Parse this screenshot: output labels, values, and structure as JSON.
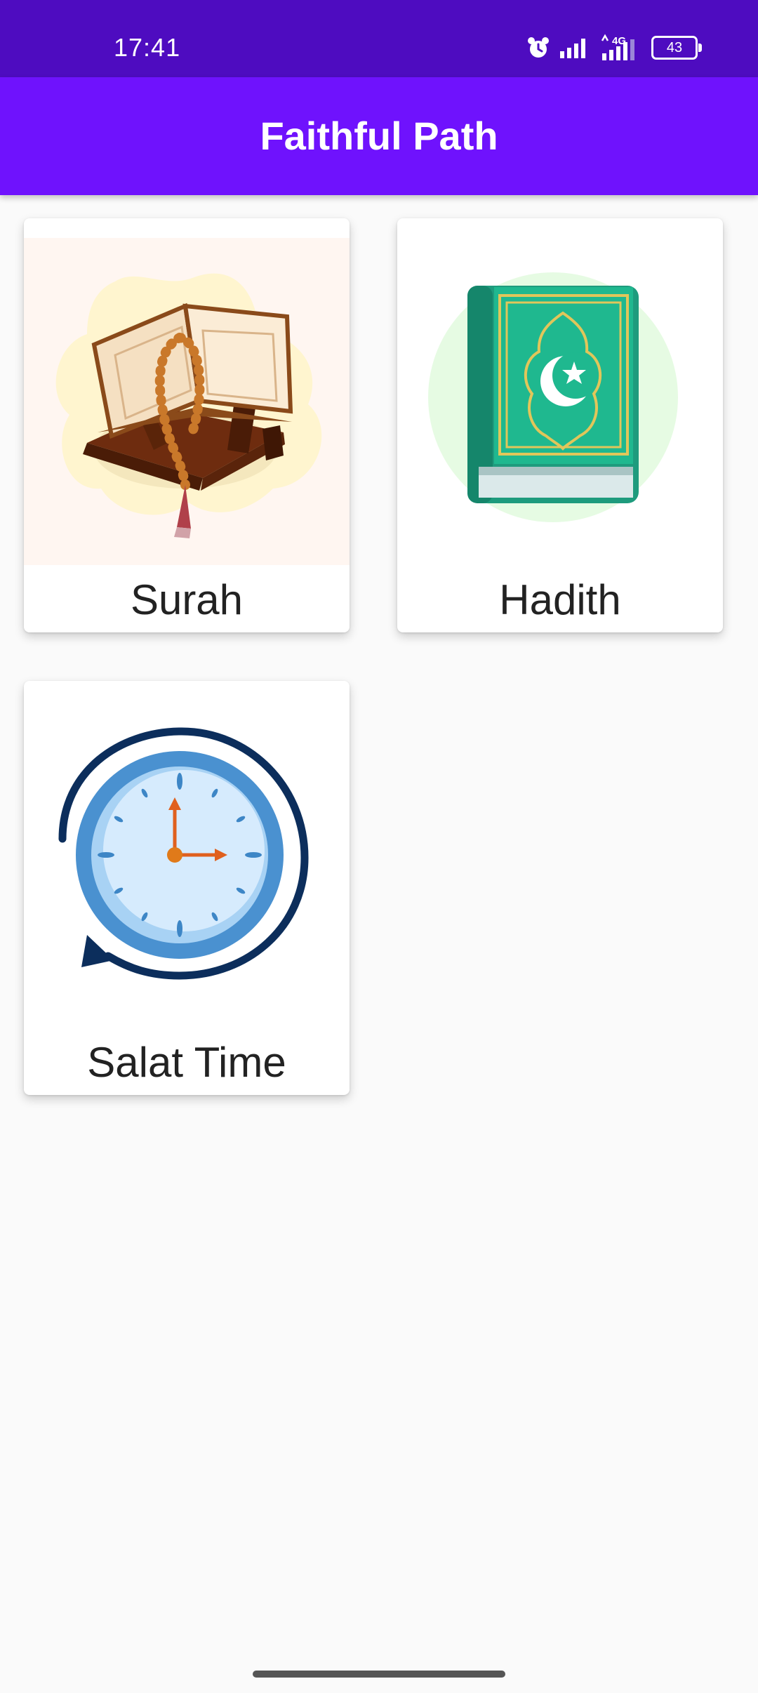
{
  "status_bar": {
    "time": "17:41",
    "network_label": "4G",
    "battery_level": "43",
    "icons": [
      "alarm-icon",
      "signal-icon",
      "signal-4g-icon",
      "battery-icon"
    ]
  },
  "app_bar": {
    "title": "Faithful Path"
  },
  "menu": {
    "items": [
      {
        "label": "Surah",
        "icon": "quran-on-stand-icon"
      },
      {
        "label": "Hadith",
        "icon": "hadith-book-icon"
      },
      {
        "label": "Salat Time",
        "icon": "clock-icon"
      }
    ]
  },
  "colors": {
    "status_bar": "#4e0cc0",
    "app_bar": "#6f12fd",
    "background": "#fafafa",
    "card": "#ffffff"
  }
}
